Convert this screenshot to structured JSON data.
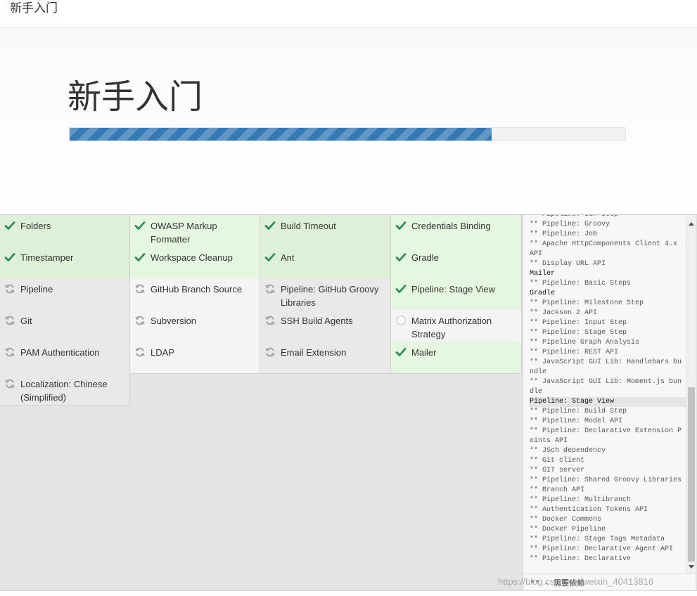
{
  "window": {
    "title": "新手入门"
  },
  "hero": {
    "heading": "新手入门",
    "progress_percent": 76
  },
  "plugins": [
    {
      "label": "Folders",
      "status": "success"
    },
    {
      "label": "OWASP Markup Formatter",
      "status": "success"
    },
    {
      "label": "Build Timeout",
      "status": "success"
    },
    {
      "label": "Credentials Binding",
      "status": "success"
    },
    {
      "label": "Timestamper",
      "status": "success"
    },
    {
      "label": "Workspace Cleanup",
      "status": "success"
    },
    {
      "label": "Ant",
      "status": "success"
    },
    {
      "label": "Gradle",
      "status": "success"
    },
    {
      "label": "Pipeline",
      "status": "pending"
    },
    {
      "label": "GitHub Branch Source",
      "status": "pending"
    },
    {
      "label": "Pipeline: GitHub Groovy Libraries",
      "status": "pending"
    },
    {
      "label": "Pipeline: Stage View",
      "status": "success"
    },
    {
      "label": "Git",
      "status": "pending"
    },
    {
      "label": "Subversion",
      "status": "pending"
    },
    {
      "label": "SSH Build Agents",
      "status": "pending"
    },
    {
      "label": "Matrix Authorization Strategy",
      "status": "none"
    },
    {
      "label": "PAM Authentication",
      "status": "pending"
    },
    {
      "label": "LDAP",
      "status": "pending"
    },
    {
      "label": "Email Extension",
      "status": "pending"
    },
    {
      "label": "Mailer",
      "status": "success"
    },
    {
      "label": "Localization: Chinese (Simplified)",
      "status": "pending"
    }
  ],
  "icons": {
    "success": "check-icon",
    "pending": "refresh-icon",
    "none": "empty-circle-icon"
  },
  "colors": {
    "success_check": "#2e8b57",
    "pending_icon": "#999999",
    "progress_bar": "#337ab7"
  },
  "log": {
    "lines": [
      {
        "text": "** Pipeline: SCM Step",
        "type": "dep"
      },
      {
        "text": "** Pipeline: Groovy",
        "type": "dep"
      },
      {
        "text": "** Pipeline: Job",
        "type": "dep"
      },
      {
        "text": "** Apache HttpComponents Client 4.x API",
        "type": "dep"
      },
      {
        "text": "** Display URL API",
        "type": "dep"
      },
      {
        "text": "Mailer",
        "type": "head"
      },
      {
        "text": "** Pipeline: Basic Steps",
        "type": "dep"
      },
      {
        "text": "Gradle",
        "type": "head"
      },
      {
        "text": "** Pipeline: Milestone Step",
        "type": "dep"
      },
      {
        "text": "** Jackson 2 API",
        "type": "dep"
      },
      {
        "text": "** Pipeline: Input Step",
        "type": "dep"
      },
      {
        "text": "** Pipeline: Stage Step",
        "type": "dep"
      },
      {
        "text": "** Pipeline Graph Analysis",
        "type": "dep"
      },
      {
        "text": "** Pipeline: REST API",
        "type": "dep"
      },
      {
        "text": "** JavaScript GUI Lib: Handlebars bundle",
        "type": "dep"
      },
      {
        "text": "** JavaScript GUI Lib: Moment.js bundle",
        "type": "dep"
      },
      {
        "text": "Pipeline: Stage View",
        "type": "hl"
      },
      {
        "text": "** Pipeline: Build Step",
        "type": "dep"
      },
      {
        "text": "** Pipeline: Model API",
        "type": "dep"
      },
      {
        "text": "** Pipeline: Declarative Extension Points API",
        "type": "dep"
      },
      {
        "text": "** JSch dependency",
        "type": "dep"
      },
      {
        "text": "** Git client",
        "type": "dep"
      },
      {
        "text": "** GIT server",
        "type": "dep"
      },
      {
        "text": "** Pipeline: Shared Groovy Libraries",
        "type": "dep"
      },
      {
        "text": "** Branch API",
        "type": "dep"
      },
      {
        "text": "** Pipeline: Multibranch",
        "type": "dep"
      },
      {
        "text": "** Authentication Tokens API",
        "type": "dep"
      },
      {
        "text": "** Docker Commons",
        "type": "dep"
      },
      {
        "text": "** Docker Pipeline",
        "type": "dep"
      },
      {
        "text": "** Pipeline: Stage Tags Metadata",
        "type": "dep"
      },
      {
        "text": "** Pipeline: Declarative Agent API",
        "type": "dep"
      },
      {
        "text": "** Pipeline: Declarative",
        "type": "dep"
      }
    ],
    "footer": "** - 需要依赖"
  },
  "watermark": "https://blog.csdn.net/weixin_40413816"
}
